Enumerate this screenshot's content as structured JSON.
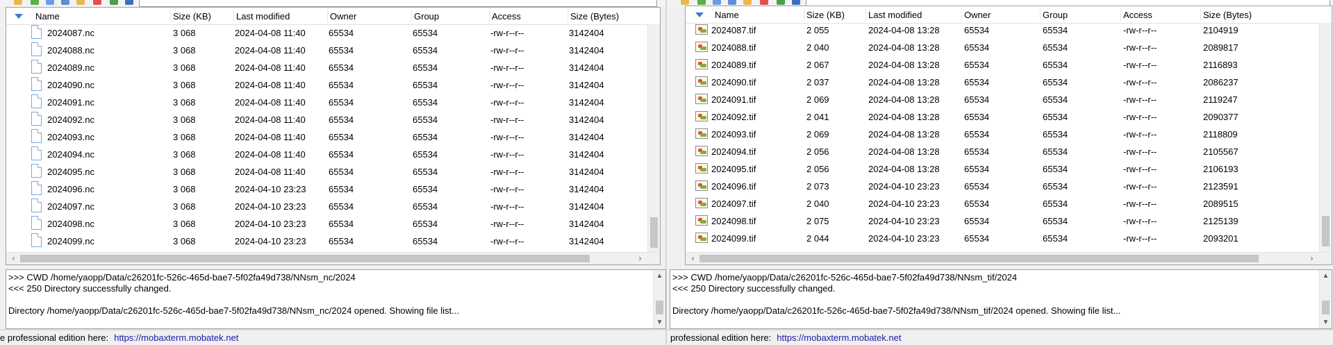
{
  "left_pane": {
    "columns": [
      "Name",
      "Size (KB)",
      "Last modified",
      "Owner",
      "Group",
      "Access",
      "Size (Bytes)"
    ],
    "files": [
      {
        "name": "2024087.nc",
        "size_kb": "3 068",
        "modified": "2024-04-08 11:40",
        "owner": "65534",
        "group": "65534",
        "access": "-rw-r--r--",
        "size_bytes": "3142404"
      },
      {
        "name": "2024088.nc",
        "size_kb": "3 068",
        "modified": "2024-04-08 11:40",
        "owner": "65534",
        "group": "65534",
        "access": "-rw-r--r--",
        "size_bytes": "3142404"
      },
      {
        "name": "2024089.nc",
        "size_kb": "3 068",
        "modified": "2024-04-08 11:40",
        "owner": "65534",
        "group": "65534",
        "access": "-rw-r--r--",
        "size_bytes": "3142404"
      },
      {
        "name": "2024090.nc",
        "size_kb": "3 068",
        "modified": "2024-04-08 11:40",
        "owner": "65534",
        "group": "65534",
        "access": "-rw-r--r--",
        "size_bytes": "3142404"
      },
      {
        "name": "2024091.nc",
        "size_kb": "3 068",
        "modified": "2024-04-08 11:40",
        "owner": "65534",
        "group": "65534",
        "access": "-rw-r--r--",
        "size_bytes": "3142404"
      },
      {
        "name": "2024092.nc",
        "size_kb": "3 068",
        "modified": "2024-04-08 11:40",
        "owner": "65534",
        "group": "65534",
        "access": "-rw-r--r--",
        "size_bytes": "3142404"
      },
      {
        "name": "2024093.nc",
        "size_kb": "3 068",
        "modified": "2024-04-08 11:40",
        "owner": "65534",
        "group": "65534",
        "access": "-rw-r--r--",
        "size_bytes": "3142404"
      },
      {
        "name": "2024094.nc",
        "size_kb": "3 068",
        "modified": "2024-04-08 11:40",
        "owner": "65534",
        "group": "65534",
        "access": "-rw-r--r--",
        "size_bytes": "3142404"
      },
      {
        "name": "2024095.nc",
        "size_kb": "3 068",
        "modified": "2024-04-08 11:40",
        "owner": "65534",
        "group": "65534",
        "access": "-rw-r--r--",
        "size_bytes": "3142404"
      },
      {
        "name": "2024096.nc",
        "size_kb": "3 068",
        "modified": "2024-04-10 23:23",
        "owner": "65534",
        "group": "65534",
        "access": "-rw-r--r--",
        "size_bytes": "3142404"
      },
      {
        "name": "2024097.nc",
        "size_kb": "3 068",
        "modified": "2024-04-10 23:23",
        "owner": "65534",
        "group": "65534",
        "access": "-rw-r--r--",
        "size_bytes": "3142404"
      },
      {
        "name": "2024098.nc",
        "size_kb": "3 068",
        "modified": "2024-04-10 23:23",
        "owner": "65534",
        "group": "65534",
        "access": "-rw-r--r--",
        "size_bytes": "3142404"
      },
      {
        "name": "2024099.nc",
        "size_kb": "3 068",
        "modified": "2024-04-10 23:23",
        "owner": "65534",
        "group": "65534",
        "access": "-rw-r--r--",
        "size_bytes": "3142404"
      }
    ],
    "log": [
      ">>>  CWD /home/yaopp/Data/c26201fc-526c-465d-bae7-5f02fa49d738/NNsm_nc/2024",
      "<<<  250 Directory successfully changed.",
      "",
      "Directory /home/yaopp/Data/c26201fc-526c-465d-bae7-5f02fa49d738/NNsm_nc/2024 opened. Showing file list..."
    ],
    "footer_text": "e professional edition here:",
    "footer_link": "https://mobaxterm.mobatek.net"
  },
  "right_pane": {
    "columns": [
      "Name",
      "Size (KB)",
      "Last modified",
      "Owner",
      "Group",
      "Access",
      "Size (Bytes)"
    ],
    "files": [
      {
        "name": "2024087.tif",
        "size_kb": "2 055",
        "modified": "2024-04-08 13:28",
        "owner": "65534",
        "group": "65534",
        "access": "-rw-r--r--",
        "size_bytes": "2104919"
      },
      {
        "name": "2024088.tif",
        "size_kb": "2 040",
        "modified": "2024-04-08 13:28",
        "owner": "65534",
        "group": "65534",
        "access": "-rw-r--r--",
        "size_bytes": "2089817"
      },
      {
        "name": "2024089.tif",
        "size_kb": "2 067",
        "modified": "2024-04-08 13:28",
        "owner": "65534",
        "group": "65534",
        "access": "-rw-r--r--",
        "size_bytes": "2116893"
      },
      {
        "name": "2024090.tif",
        "size_kb": "2 037",
        "modified": "2024-04-08 13:28",
        "owner": "65534",
        "group": "65534",
        "access": "-rw-r--r--",
        "size_bytes": "2086237"
      },
      {
        "name": "2024091.tif",
        "size_kb": "2 069",
        "modified": "2024-04-08 13:28",
        "owner": "65534",
        "group": "65534",
        "access": "-rw-r--r--",
        "size_bytes": "2119247"
      },
      {
        "name": "2024092.tif",
        "size_kb": "2 041",
        "modified": "2024-04-08 13:28",
        "owner": "65534",
        "group": "65534",
        "access": "-rw-r--r--",
        "size_bytes": "2090377"
      },
      {
        "name": "2024093.tif",
        "size_kb": "2 069",
        "modified": "2024-04-08 13:28",
        "owner": "65534",
        "group": "65534",
        "access": "-rw-r--r--",
        "size_bytes": "2118809"
      },
      {
        "name": "2024094.tif",
        "size_kb": "2 056",
        "modified": "2024-04-08 13:28",
        "owner": "65534",
        "group": "65534",
        "access": "-rw-r--r--",
        "size_bytes": "2105567"
      },
      {
        "name": "2024095.tif",
        "size_kb": "2 056",
        "modified": "2024-04-08 13:28",
        "owner": "65534",
        "group": "65534",
        "access": "-rw-r--r--",
        "size_bytes": "2106193"
      },
      {
        "name": "2024096.tif",
        "size_kb": "2 073",
        "modified": "2024-04-10 23:23",
        "owner": "65534",
        "group": "65534",
        "access": "-rw-r--r--",
        "size_bytes": "2123591"
      },
      {
        "name": "2024097.tif",
        "size_kb": "2 040",
        "modified": "2024-04-10 23:23",
        "owner": "65534",
        "group": "65534",
        "access": "-rw-r--r--",
        "size_bytes": "2089515"
      },
      {
        "name": "2024098.tif",
        "size_kb": "2 075",
        "modified": "2024-04-10 23:23",
        "owner": "65534",
        "group": "65534",
        "access": "-rw-r--r--",
        "size_bytes": "2125139"
      },
      {
        "name": "2024099.tif",
        "size_kb": "2 044",
        "modified": "2024-04-10 23:23",
        "owner": "65534",
        "group": "65534",
        "access": "-rw-r--r--",
        "size_bytes": "2093201"
      }
    ],
    "log": [
      ">>>  CWD /home/yaopp/Data/c26201fc-526c-465d-bae7-5f02fa49d738/NNsm_tif/2024",
      "<<<  250 Directory successfully changed.",
      "",
      "Directory /home/yaopp/Data/c26201fc-526c-465d-bae7-5f02fa49d738/NNsm_tif/2024 opened. Showing file list..."
    ],
    "footer_text": "professional edition here:",
    "footer_link": "https://mobaxterm.mobatek.net"
  },
  "colors": {
    "link": "#1a1aa6",
    "sort_arrow": "#3a7bd5",
    "panel_bg": "#f0f0f0"
  },
  "icons": {
    "nc_file": "document-icon",
    "tif_file": "image-file-icon",
    "sort": "sort-descending-icon"
  }
}
